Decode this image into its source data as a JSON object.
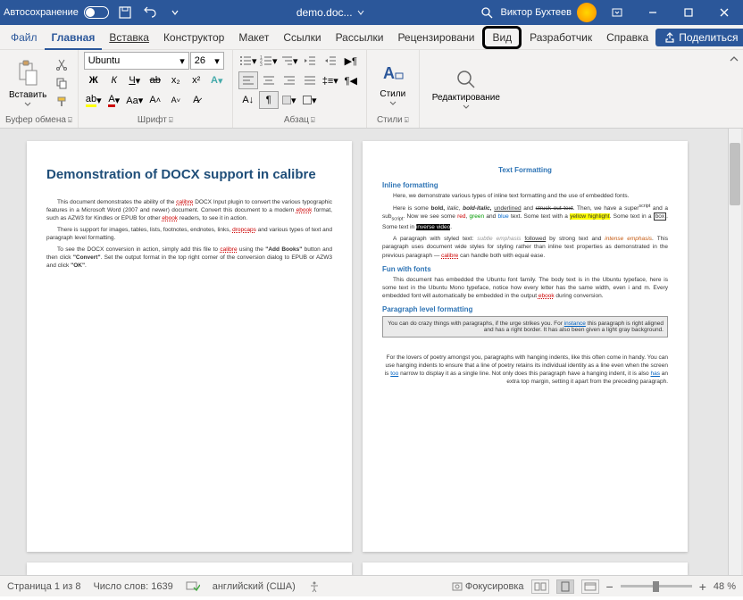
{
  "titlebar": {
    "autosave": "Автосохранение",
    "doc_name": "demo.doc...",
    "user": "Виктор Бухтеев"
  },
  "tabs": {
    "file": "Файл",
    "home": "Главная",
    "insert": "Вставка",
    "design": "Конструктор",
    "layout": "Макет",
    "references": "Ссылки",
    "mailings": "Рассылки",
    "review": "Рецензировани",
    "view": "Вид",
    "developer": "Разработчик",
    "help": "Справка",
    "share": "Поделиться"
  },
  "ribbon": {
    "clipboard": {
      "paste": "Вставить",
      "label": "Буфер обмена"
    },
    "font": {
      "name": "Ubuntu",
      "size": "26",
      "label": "Шрифт"
    },
    "para": {
      "label": "Абзац"
    },
    "styles": {
      "btn": "Стили",
      "label": "Стили"
    },
    "editing": {
      "btn": "Редактирование"
    }
  },
  "page1": {
    "title": "Demonstration of DOCX support in calibre",
    "p1a": "This document demonstrates the ability of the ",
    "p1b": " DOCX Input plugin to convert the various typographic features in a Microsoft Word (2007 and newer) document. Convert this document to a modern ",
    "p1c": " format, such as AZW3 for Kindles or EPUB for other ",
    "p1d": " readers, to see it in action.",
    "p2a": "There is support for images, tables, lists, footnotes, endnotes, links, ",
    "p2b": " and various types of text and paragraph level formatting.",
    "p3a": "To see the DOCX conversion in action, simply add this file to ",
    "p3b": " using the ",
    "p3c": "\"Add Books\"",
    "p3d": " button and then click ",
    "p3e": "\"Convert\"",
    "p3f": ". Set the output format in the top right corner of the conversion dialog to EPUB or AZW3 and click ",
    "p3g": "\"OK\"",
    "calibre": "calibre",
    "ebook": "ebook",
    "dropcaps": "dropcaps"
  },
  "page2": {
    "h_main": "Text Formatting",
    "h_inline": "Inline formatting",
    "p1": "Here, we demonstrate various types of inline text formatting and the use of embedded fonts.",
    "p2a": "Here is some ",
    "p2_bold": "bold,",
    "p2_italic": " italic, ",
    "p2_bi": "bold-italic, ",
    "p2_u": "underlined",
    "p2b": " and ",
    "p2_strike": "struck out text",
    "p2c": ". Then, we have a super",
    "p2_sup": "script",
    "p2d": " and a sub",
    "p2_sub": "script",
    "p2e": ". Now we see some ",
    "p2_red": "red",
    "p2f": ", ",
    "p2_green": "green",
    "p2g": " and ",
    "p2_blue": "blue",
    "p2h": " text. Some text with a ",
    "p2_hl": "yellow highlight",
    "p2i": ". Some text in a ",
    "p2_box": "box",
    "p2j": ". Some text in ",
    "p2_inv": "inverse video",
    "p2k": ".",
    "p3a": "A paragraph with styled text: ",
    "p3_subtle": "subtle emphasis ",
    "p3b": "followed",
    "p3c": " by strong text and ",
    "p3_intense": "intense emphasis",
    "p3d": ". This paragraph uses document wide styles for styling rather than inline text properties as demonstrated in the previous paragraph — ",
    "p3e": " can handle both with equal ease.",
    "h_fun": "Fun with fonts",
    "p4a": "This document has embedded the Ubuntu font family. The body text is in the Ubuntu typeface, here is some text in the Ubuntu Mono typeface, notice how every letter has the same width, even i and m. Every embedded font will automatically be embedded in the output ",
    "p4b": " during conversion.",
    "h_para": "Paragraph level formatting",
    "p5a": "You can do crazy things with paragraphs, if the urge strikes you. For ",
    "p5_inst": "instance",
    "p5b": " this paragraph is right aligned and has a right border. It has also been given a light gray background.",
    "p6a": "For the lovers of poetry amongst you, paragraphs with hanging indents, like this often come in handy. You can use hanging indents to ensure that a line of poetry retains its individual identity as a line even when the screen is ",
    "p6_too": "too",
    "p6b": " narrow to display it as a single line. Not only does this paragraph have a hanging indent, it is also ",
    "p6_has": "has",
    "p6c": " an extra top margin, setting it apart from the preceding paragraph."
  },
  "statusbar": {
    "page": "Страница 1 из 8",
    "words": "Число слов: 1639",
    "lang": "английский (США)",
    "focus": "Фокусировка",
    "zoom": "48 %"
  }
}
